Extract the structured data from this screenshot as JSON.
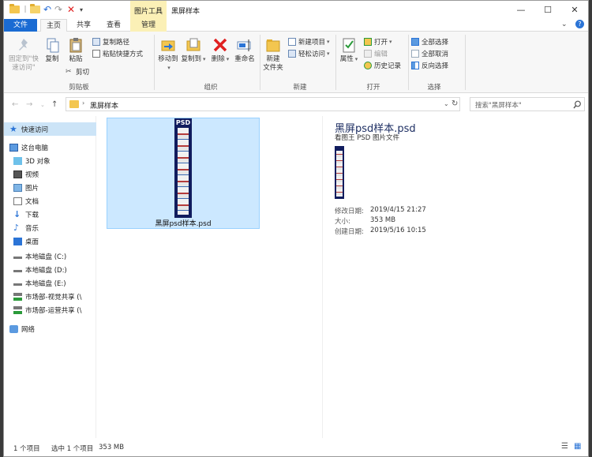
{
  "titlebar": {
    "context_tab": "图片工具",
    "title": "黑屏样本",
    "minimize": "—",
    "maximize": "☐",
    "close": "✕"
  },
  "tabs": {
    "file": "文件",
    "home": "主页",
    "share": "共享",
    "view": "查看",
    "manage": "管理"
  },
  "ribbon": {
    "pin": "固定到\"快\n速访问\"",
    "copy": "复制",
    "paste": "粘贴",
    "copy_path": "复制路径",
    "paste_shortcut": "粘贴快捷方式",
    "cut": "剪切",
    "group_clipboard": "剪贴板",
    "move_to": "移动到",
    "copy_to": "复制到",
    "delete": "删除",
    "rename": "重命名",
    "group_organize": "组织",
    "new_folder": "新建\n文件夹",
    "new_item": "新建项目",
    "easy_access": "轻松访问",
    "group_new": "新建",
    "properties": "属性",
    "open": "打开",
    "edit": "编辑",
    "history": "历史记录",
    "group_open": "打开",
    "select_all": "全部选择",
    "select_none": "全部取消",
    "invert_selection": "反向选择",
    "group_select": "选择"
  },
  "address": {
    "path": "黑屏样本",
    "search_placeholder": "搜索\"黑屏样本\""
  },
  "sidebar": {
    "items": [
      {
        "label": "快速访问"
      },
      {
        "label": "这台电脑"
      },
      {
        "label": "3D 对象"
      },
      {
        "label": "视频"
      },
      {
        "label": "图片"
      },
      {
        "label": "文档"
      },
      {
        "label": "下载"
      },
      {
        "label": "音乐"
      },
      {
        "label": "桌面"
      },
      {
        "label": "本地磁盘 (C:)"
      },
      {
        "label": "本地磁盘 (D:)"
      },
      {
        "label": "本地磁盘 (E:)"
      },
      {
        "label": "市场部-视觉共享 (\\"
      },
      {
        "label": "市场部-运营共享 (\\"
      },
      {
        "label": "网络"
      }
    ]
  },
  "file": {
    "name": "黑屏psd样本.psd",
    "thumb_label": "PSD"
  },
  "preview": {
    "title": "黑屏psd样本.psd",
    "subtitle": "看图王 PSD 图片文件",
    "modified_label": "修改日期:",
    "modified_value": "2019/4/15 21:27",
    "size_label": "大小:",
    "size_value": "353 MB",
    "created_label": "创建日期:",
    "created_value": "2019/5/16 10:15"
  },
  "status": {
    "count": "1 个项目",
    "selected": "选中 1 个项目",
    "size": "353 MB"
  }
}
